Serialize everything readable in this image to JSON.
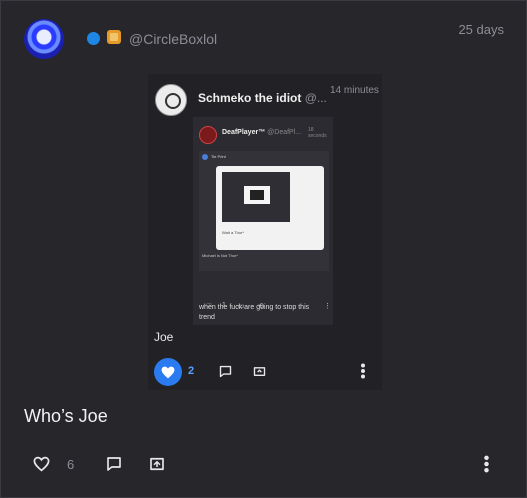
{
  "post": {
    "author_handle": "@CircleBoxlol",
    "age": "25 days",
    "caption": "Who’s Joe",
    "like_count": "6",
    "icons": {
      "verified": "verified-dot-icon",
      "box": "box-badge-icon",
      "like": "heart-outline-icon",
      "comment": "comment-icon",
      "reshare": "reshare-icon",
      "more": "more-vertical-icon"
    },
    "colors": {
      "background": "#26262b",
      "accent": "#2a7bf0",
      "muted": "#8d8d96"
    }
  },
  "embed": {
    "author_name": "Schmeko the idiot",
    "author_handle_trunc": "@...",
    "age": "14 minutes",
    "text": "Joe",
    "like_count": "2",
    "liked": true,
    "inner": {
      "author_name": "DeafPlayer™",
      "author_handle_trunc": "@DeafPl...",
      "age": "18 seconds",
      "sub_author": "Tie Print",
      "sub_card_text": "Wait a Thor*",
      "sub_caption": "Michael is Not Thor*",
      "text": "when the fuck are going to stop this trend",
      "like_count": "1"
    }
  }
}
